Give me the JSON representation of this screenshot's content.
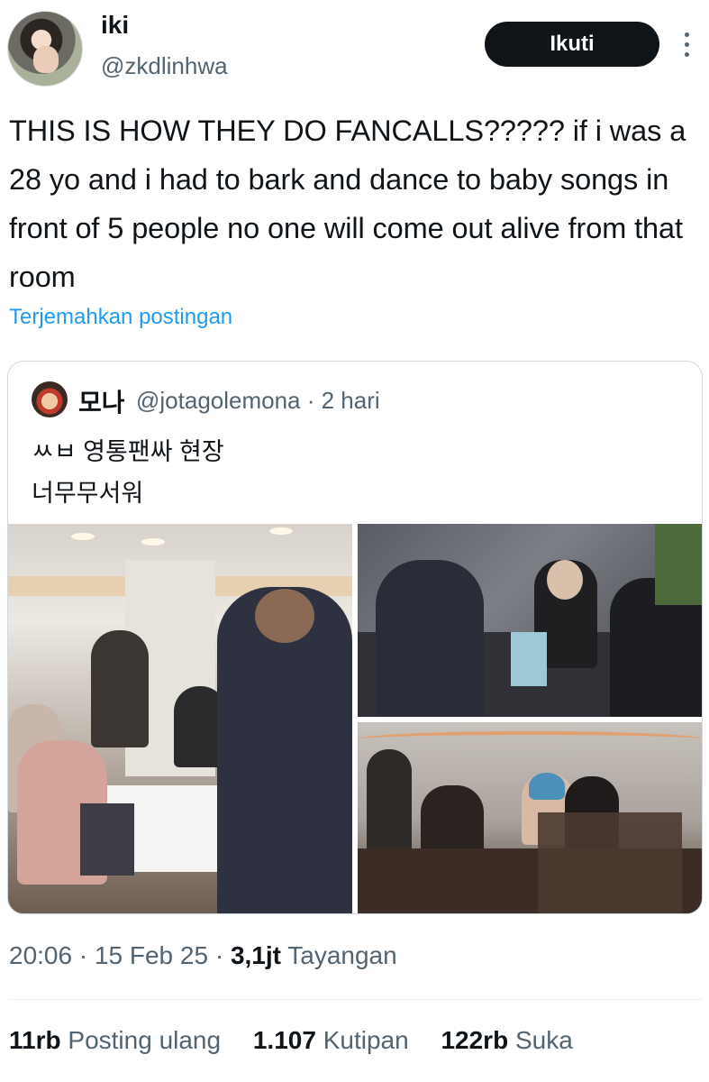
{
  "author": {
    "display_name": "iki",
    "handle": "@zkdlinhwa",
    "avatar_icon": "profile-photo"
  },
  "follow_label": "Ikuti",
  "more_icon": "more-vertical-icon",
  "tweet_text": "THIS IS HOW THEY DO FANCALLS????? if i was a 28 yo and i had to bark and dance to baby songs in front of 5 people no one will come out alive from that room",
  "translate_label": "Terjemahkan postingan",
  "quoted": {
    "display_name": "모나",
    "meta": "@jotagolemona · 2 hari",
    "line1": "ㅆㅂ 영통팬싸 현장",
    "line2": "너무무서워",
    "images": [
      "photo-1",
      "photo-2",
      "photo-3"
    ]
  },
  "meta": {
    "time_date": "20:06 · 15 Feb 25 · ",
    "views_count": "3,1jt",
    "views_label": " Tayangan"
  },
  "stats": {
    "reposts_count": "11rb",
    "reposts_label": "Posting ulang",
    "quotes_count": "1.107",
    "quotes_label": "Kutipan",
    "likes_count": "122rb",
    "likes_label": "Suka"
  },
  "colors": {
    "link": "#1d9bf0",
    "muted": "#536471",
    "text": "#0f1419",
    "button_bg": "#0f1419"
  }
}
